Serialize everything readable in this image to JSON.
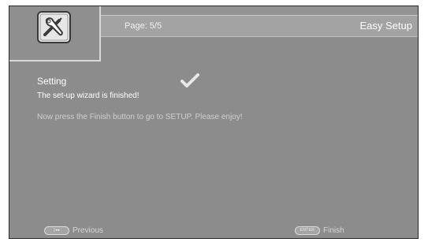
{
  "header": {
    "page_label": "Page: 5/5",
    "title": "Easy Setup"
  },
  "icons": {
    "setup_icon": "wrench-screwdriver-icon",
    "status_icon": "checkmark-icon"
  },
  "content": {
    "setting_title": "Setting",
    "finished_message": "The set-up wizard is finished!",
    "instructions": "Now press the Finish button to go to SETUP. Please enjoy!"
  },
  "footer": {
    "previous_key": "|◂◂",
    "previous_label": "Previous",
    "finish_key": "ENTER",
    "finish_label": "Finish"
  },
  "colors": {
    "background": "#8c8c8c",
    "header_bar": "#a3a3a3",
    "accent_border": "#d9d9d9"
  }
}
